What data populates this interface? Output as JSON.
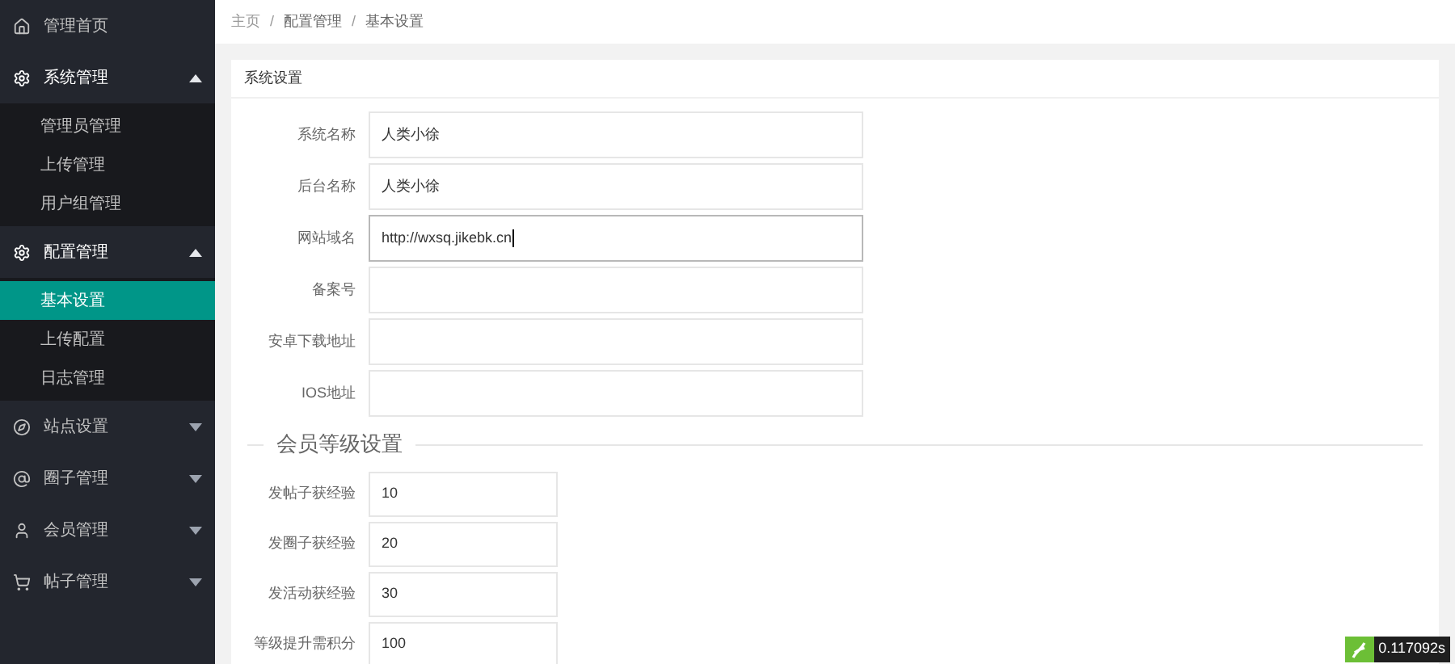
{
  "sidebar": {
    "items": [
      {
        "label": "管理首页"
      },
      {
        "label": "系统管理",
        "expanded": true,
        "children": [
          {
            "label": "管理员管理",
            "selected": false
          },
          {
            "label": "上传管理",
            "selected": false
          },
          {
            "label": "用户组管理",
            "selected": false
          }
        ]
      },
      {
        "label": "配置管理",
        "expanded": true,
        "children": [
          {
            "label": "基本设置",
            "selected": true
          },
          {
            "label": "上传配置",
            "selected": false
          },
          {
            "label": "日志管理",
            "selected": false
          }
        ]
      },
      {
        "label": "站点设置",
        "expanded": false
      },
      {
        "label": "圈子管理",
        "expanded": false
      },
      {
        "label": "会员管理",
        "expanded": false
      },
      {
        "label": "帖子管理",
        "expanded": false
      }
    ]
  },
  "breadcrumb": {
    "separator": "/",
    "items": [
      "主页",
      "配置管理",
      "基本设置"
    ]
  },
  "card": {
    "title": "系统设置",
    "fields": [
      {
        "label": "系统名称",
        "value": "人类小徐",
        "focused": false
      },
      {
        "label": "后台名称",
        "value": "人类小徐",
        "focused": false
      },
      {
        "label": "网站域名",
        "value": "http://wxsq.jikebk.cn",
        "focused": true
      },
      {
        "label": "备案号",
        "focused": false
      },
      {
        "label": "安卓下载地址",
        "focused": false
      },
      {
        "label": "IOS地址",
        "focused": false
      }
    ],
    "section_title": "会员等级设置",
    "level_fields": [
      {
        "label": "发帖子获经验",
        "value": "10"
      },
      {
        "label": "发圈子获经验",
        "value": "20"
      },
      {
        "label": "发活动获经验",
        "value": "30"
      },
      {
        "label": "等级提升需积分",
        "value": "100"
      }
    ]
  },
  "timer": "0.117092s"
}
